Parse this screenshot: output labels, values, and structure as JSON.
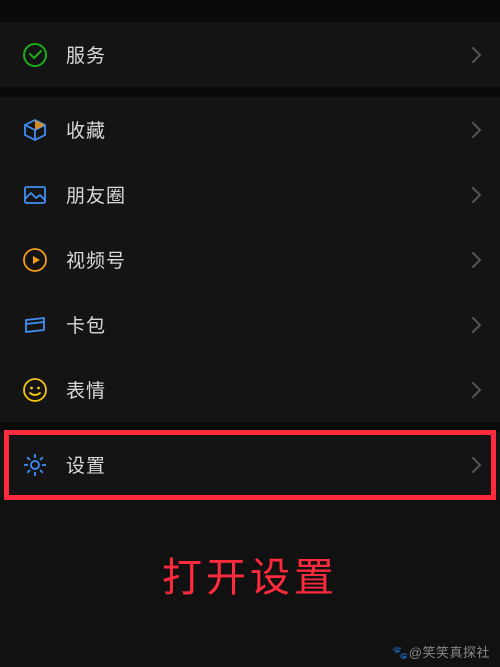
{
  "colors": {
    "green": "#1aad19",
    "blue": "#3f8ff5",
    "orange": "#f59b1e",
    "yellow": "#f5c518",
    "red": "#ff2a3c",
    "chevron": "#555"
  },
  "section1": {
    "items": [
      {
        "key": "services",
        "label": "服务",
        "icon": "wechat-pay-icon"
      }
    ]
  },
  "section2": {
    "items": [
      {
        "key": "favorites",
        "label": "收藏",
        "icon": "cube-icon"
      },
      {
        "key": "moments",
        "label": "朋友圈",
        "icon": "image-icon"
      },
      {
        "key": "channels",
        "label": "视频号",
        "icon": "play-circle-icon"
      },
      {
        "key": "cards",
        "label": "卡包",
        "icon": "card-icon"
      },
      {
        "key": "stickers",
        "label": "表情",
        "icon": "smile-icon"
      }
    ]
  },
  "section3": {
    "items": [
      {
        "key": "settings",
        "label": "设置",
        "icon": "gear-icon"
      }
    ]
  },
  "annotation": {
    "text": "打开设置"
  },
  "watermark": {
    "text": "@笑笑真探社"
  }
}
